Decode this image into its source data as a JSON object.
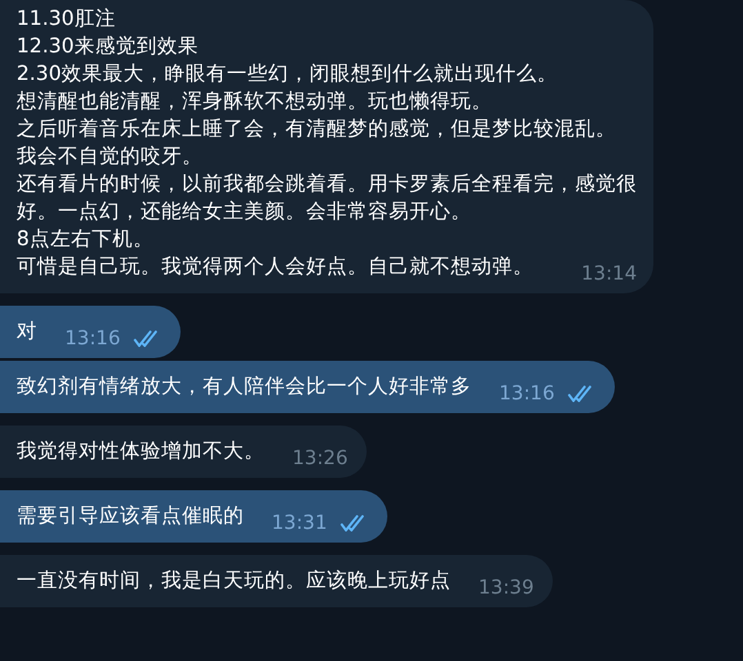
{
  "messages": [
    {
      "kind": "incoming",
      "lines": [
        "11.30肛注",
        "12.30来感觉到效果",
        "2.30效果最大，睁眼有一些幻，闭眼想到什么就出现什么。",
        "想清醒也能清醒，浑身酥软不想动弹。玩也懒得玩。",
        "之后听着音乐在床上睡了会，有清醒梦的感觉，但是梦比较混乱。",
        "我会不自觉的咬牙。",
        "还有看片的时候，以前我都会跳着看。用卡罗素后全程看完，感觉很",
        "好。一点幻，还能给女主美颜。会非常容易开心。",
        "8点左右下机。",
        "可惜是自己玩。我觉得两个人会好点。自己就不想动弹。"
      ],
      "time": "13:14"
    },
    {
      "kind": "outgoing",
      "lines": [
        "对"
      ],
      "time": "13:16",
      "read": true
    },
    {
      "kind": "outgoing",
      "lines": [
        "致幻剂有情绪放大，有人陪伴会比一个人好非常多"
      ],
      "time": "13:16",
      "read": true
    },
    {
      "kind": "incoming",
      "lines": [
        "我觉得对性体验增加不大。"
      ],
      "time": "13:26"
    },
    {
      "kind": "outgoing",
      "lines": [
        "需要引导应该看点催眠的"
      ],
      "time": "13:31",
      "read": true
    },
    {
      "kind": "incoming",
      "lines": [
        "一直没有时间，我是白天玩的。应该晚上玩好点"
      ],
      "time": "13:39"
    }
  ]
}
